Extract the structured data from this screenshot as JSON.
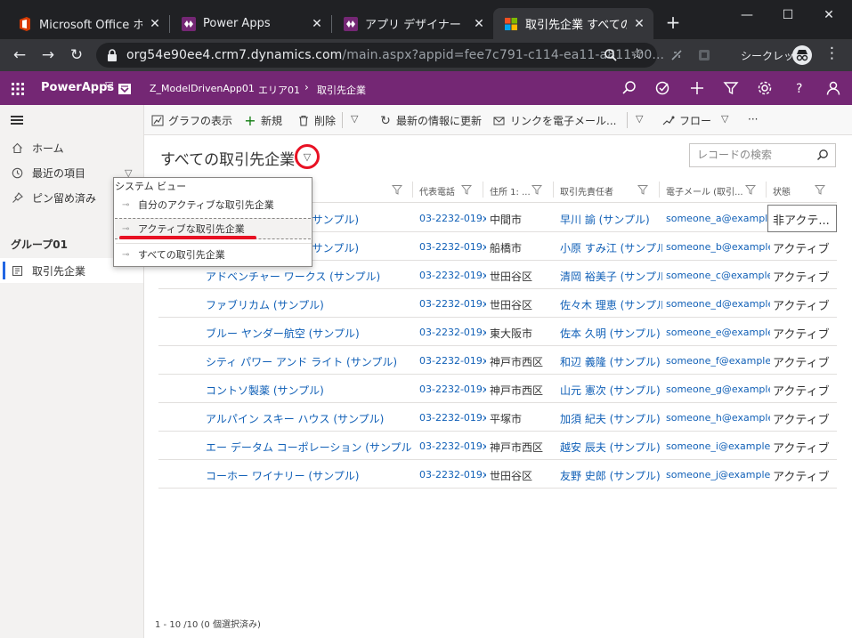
{
  "browser": {
    "tabs": [
      {
        "title": "Microsoft Office ホーム",
        "favicon": "office-logo-icon",
        "color": "#d83b01"
      },
      {
        "title": "Power Apps",
        "favicon": "powerapps-logo-icon",
        "color": "#742774"
      },
      {
        "title": "アプリ デザイナー",
        "favicon": "powerapps-logo-icon",
        "color": "#742774"
      },
      {
        "title": "取引先企業 すべての取",
        "favicon": "microsoft-logo-icon",
        "active": true
      }
    ],
    "new_tab": "+",
    "window_controls": {
      "minimize": "—",
      "maximize": "☐",
      "close": "✕"
    },
    "url_host": "org54e90ee4.crm7.dynamics.com",
    "url_rest": "/main.aspx?appid=fee7c791-c114-ea11-a811-00...",
    "incognito_label": "シークレット"
  },
  "appbar": {
    "brand": "PowerApps",
    "app_name": "Z_ModelDrivenApp01",
    "area": "エリア01",
    "entity": "取引先企業",
    "color": "#742774"
  },
  "nav": {
    "home": "ホーム",
    "recent": "最近の項目",
    "pinned": "ピン留め済み",
    "group": "グループ01",
    "accounts": "取引先企業"
  },
  "commands": {
    "chart": "グラフの表示",
    "new": "新規",
    "delete": "削除",
    "refresh": "最新の情報に更新",
    "email_link": "リンクを電子メール...",
    "flow": "フロー",
    "more": "···"
  },
  "view": {
    "title": "すべての取引先企業",
    "search_placeholder": "レコードの検索"
  },
  "grid": {
    "headers": {
      "phone": "代表電話",
      "city": "住所 1: ...",
      "owner": "取引先責任者",
      "email": "電子メール (取引...",
      "status": "状態"
    },
    "rows": [
      {
        "name": "(サンプル)",
        "phone": "03-2232-019x...",
        "city": "中間市",
        "owner": "早川 諭 (サンプル)",
        "email": "someone_a@example.c",
        "status": "非アクテ..."
      },
      {
        "name": "(サンプル)",
        "phone": "03-2232-019x...",
        "city": "船橋市",
        "owner": "小原 すみ江 (サンプル)",
        "email": "someone_b@example.c",
        "status": "アクティブ"
      },
      {
        "name": "アドベンチャー ワークス (サンプル)",
        "phone": "03-2232-019x...",
        "city": "世田谷区",
        "owner": "清岡 裕美子 (サンプル)",
        "email": "someone_c@example.c",
        "status": "アクティブ"
      },
      {
        "name": "ファブリカム (サンプル)",
        "phone": "03-2232-019x...",
        "city": "世田谷区",
        "owner": "佐々木 理恵 (サンプル)",
        "email": "someone_d@example.c",
        "status": "アクティブ"
      },
      {
        "name": "ブルー ヤンダー航空 (サンプル)",
        "phone": "03-2232-019x...",
        "city": "東大阪市",
        "owner": "佐本 久明 (サンプル)",
        "email": "someone_e@example.c",
        "status": "アクティブ"
      },
      {
        "name": "シティ パワー アンド ライト (サンプル)",
        "phone": "03-2232-019x...",
        "city": "神戸市西区",
        "owner": "和辺 義隆 (サンプル)",
        "email": "someone_f@example.c",
        "status": "アクティブ"
      },
      {
        "name": "コントソ製薬 (サンプル)",
        "phone": "03-2232-019x...",
        "city": "神戸市西区",
        "owner": "山元 憲次 (サンプル)",
        "email": "someone_g@example.c",
        "status": "アクティブ"
      },
      {
        "name": "アルパイン スキー ハウス (サンプル)",
        "phone": "03-2232-019x...",
        "city": "平塚市",
        "owner": "加須 紀夫 (サンプル)",
        "email": "someone_h@example.c",
        "status": "アクティブ"
      },
      {
        "name": "エー データム コーポレーション (サンプル)",
        "phone": "03-2232-019x...",
        "city": "神戸市西区",
        "owner": "越安 辰夫 (サンプル)",
        "email": "someone_i@example.c",
        "status": "アクティブ"
      },
      {
        "name": "コーホー ワイナリー (サンプル)",
        "phone": "03-2232-019x...",
        "city": "世田谷区",
        "owner": "友野 史郎 (サンプル)",
        "email": "someone_j@example.c",
        "status": "アクティブ"
      }
    ],
    "footer": "1 - 10 /10 (0 個選択済み)"
  },
  "view_dropdown": {
    "header": "システム ビュー",
    "items": [
      {
        "label": "自分のアクティブな取引先企業"
      },
      {
        "label": "アクティブな取引先企業",
        "selected": true
      },
      {
        "label": "すべての取引先企業"
      }
    ]
  }
}
